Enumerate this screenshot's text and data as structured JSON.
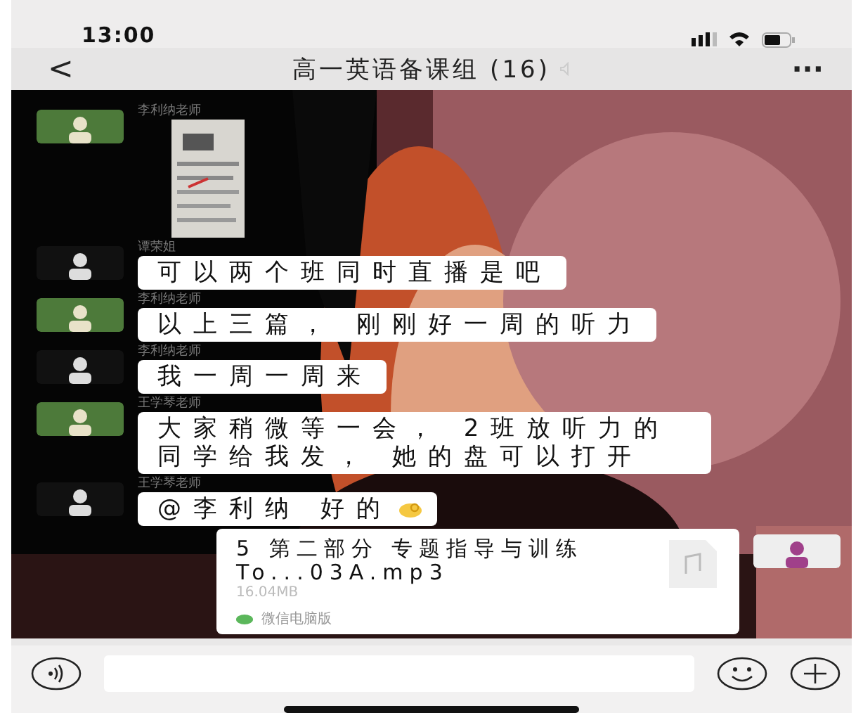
{
  "status_bar": {
    "time": "13:00"
  },
  "nav": {
    "back": "<",
    "title": "高一英语备课组 (16)",
    "more": "···"
  },
  "messages": [
    {
      "sender": "李利纳老师"
    },
    {
      "kind": "text",
      "sender": "谭荣姐",
      "text": "可以两个班同时直播是吧"
    },
    {
      "kind": "text",
      "sender": "李利纳老师",
      "text": "以上三篇， 刚刚好一周的听力"
    },
    {
      "kind": "text",
      "sender": "李利纳老师",
      "text": "我一周一周来"
    },
    {
      "kind": "text",
      "sender": "王学琴老师",
      "text": "大家稍微等一会， 2班放听力的同学给我发， 她的盘可以打开"
    },
    {
      "kind": "text",
      "sender": "王学琴老师",
      "text": "@李利纳 好的",
      "emoji": true
    },
    {
      "kind": "file",
      "file_name": "5 第二部分 专题指导与训练 To...03A.mp3",
      "size": "16.04MB",
      "source": "微信电脑版"
    }
  ]
}
